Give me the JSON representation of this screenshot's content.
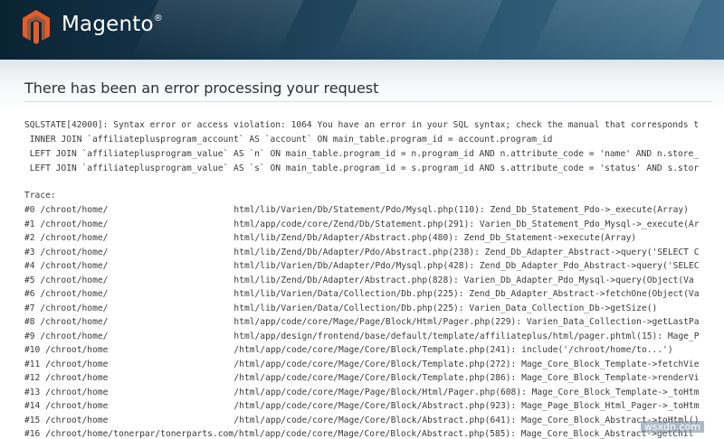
{
  "header": {
    "logo_text": "Magento",
    "logo_reg": "®",
    "brand_color": "#e45c2b",
    "logo_icon": "magento-logo-icon"
  },
  "page": {
    "title": "There has been an error processing your request"
  },
  "error": {
    "sql_lines": [
      "SQLSTATE[42000]: Syntax error or access violation: 1064 You have an error in your SQL syntax; check the manual that corresponds t",
      " INNER JOIN `affiliateplusprogram_account` AS `account` ON main_table.program_id = account.program_id",
      " LEFT JOIN `affiliateplusprogram_value` AS `n` ON main_table.program_id = n.program_id AND n.attribute_code = 'name' AND n.store_",
      " LEFT JOIN `affiliateplusprogram_value` AS `s` ON main_table.program_id = s.program_id AND s.attribute_code = 'status' AND s.stor"
    ],
    "trace_label": "Trace:",
    "trace": [
      {
        "prefix": "#0 /chroot/home/",
        "suffix": "html/lib/Varien/Db/Statement/Pdo/Mysql.php(110): Zend_Db_Statement_Pdo->_execute(Array)"
      },
      {
        "prefix": "#1 /chroot/home/",
        "suffix": "html/app/code/core/Zend/Db/Statement.php(291): Varien_Db_Statement_Pdo_Mysql->_execute(Ar"
      },
      {
        "prefix": "#2 /chroot/home/",
        "suffix": "html/lib/Zend/Db/Adapter/Abstract.php(480): Zend_Db_Statement->execute(Array)"
      },
      {
        "prefix": "#3 /chroot/home/",
        "suffix": "html/lib/Zend/Db/Adapter/Pdo/Abstract.php(238): Zend_Db_Adapter_Abstract->query('SELECT C"
      },
      {
        "prefix": "#4 /chroot/home/",
        "suffix": "html/lib/Varien/Db/Adapter/Pdo/Mysql.php(428): Zend_Db_Adapter_Pdo_Abstract->query('SELEC"
      },
      {
        "prefix": "#5 /chroot/home/",
        "suffix": "html/lib/Zend/Db/Adapter/Abstract.php(828): Varien_Db_Adapter_Pdo_Mysql->query(Object(Va"
      },
      {
        "prefix": "#6 /chroot/home/",
        "suffix": "html/lib/Varien/Data/Collection/Db.php(225): Zend_Db_Adapter_Abstract->fetchOne(Object(Va"
      },
      {
        "prefix": "#7 /chroot/home/",
        "suffix": "html/lib/Varien/Data/Collection/Db.php(225): Varien_Data_Collection_Db->getSize()"
      },
      {
        "prefix": "#8 /chroot/home/",
        "suffix": "html/app/code/core/Mage/Page/Block/Html/Pager.php(229): Varien_Data_Collection->getLastPa"
      },
      {
        "prefix": "#9 /chroot/home/",
        "suffix": "html/app/design/frontend/base/default/template/affiliateplus/html/pager.phtml(15): Mage_P"
      },
      {
        "prefix": "#10 /chroot/home",
        "suffix": "/html/app/code/core/Mage/Core/Block/Template.php(241): include('/chroot/home/to...')"
      },
      {
        "prefix": "#11 /chroot/home",
        "suffix": "/html/app/code/core/Mage/Core/Block/Template.php(272): Mage_Core_Block_Template->fetchVie"
      },
      {
        "prefix": "#12 /chroot/home",
        "suffix": "/html/app/code/core/Mage/Core/Block/Template.php(286): Mage_Core_Block_Template->renderVi"
      },
      {
        "prefix": "#13 /chroot/home",
        "suffix": "/html/app/code/core/Mage/Page/Block/Html/Pager.php(608): Mage_Core_Block_Template->_toHtm"
      },
      {
        "prefix": "#14 /chroot/home",
        "suffix": "/html/app/code/core/Mage/Core/Block/Abstract.php(923): Mage_Page_Block_Html_Pager->_toHtm"
      },
      {
        "prefix": "#15 /chroot/home",
        "suffix": "/html/app/code/core/Mage/Core/Block/Abstract.php(641): Mage_Core_Block_Abstract->toHtml()"
      },
      {
        "prefix": "#16 /chroot/home/tonerpar/tonerparts.com/",
        "suffix": "html/app/code/core/Mage/Core/Block/Abstract.php(585): Mage_Core_Block_Abstract->getChil"
      }
    ]
  },
  "watermark": "wsxdn.com"
}
